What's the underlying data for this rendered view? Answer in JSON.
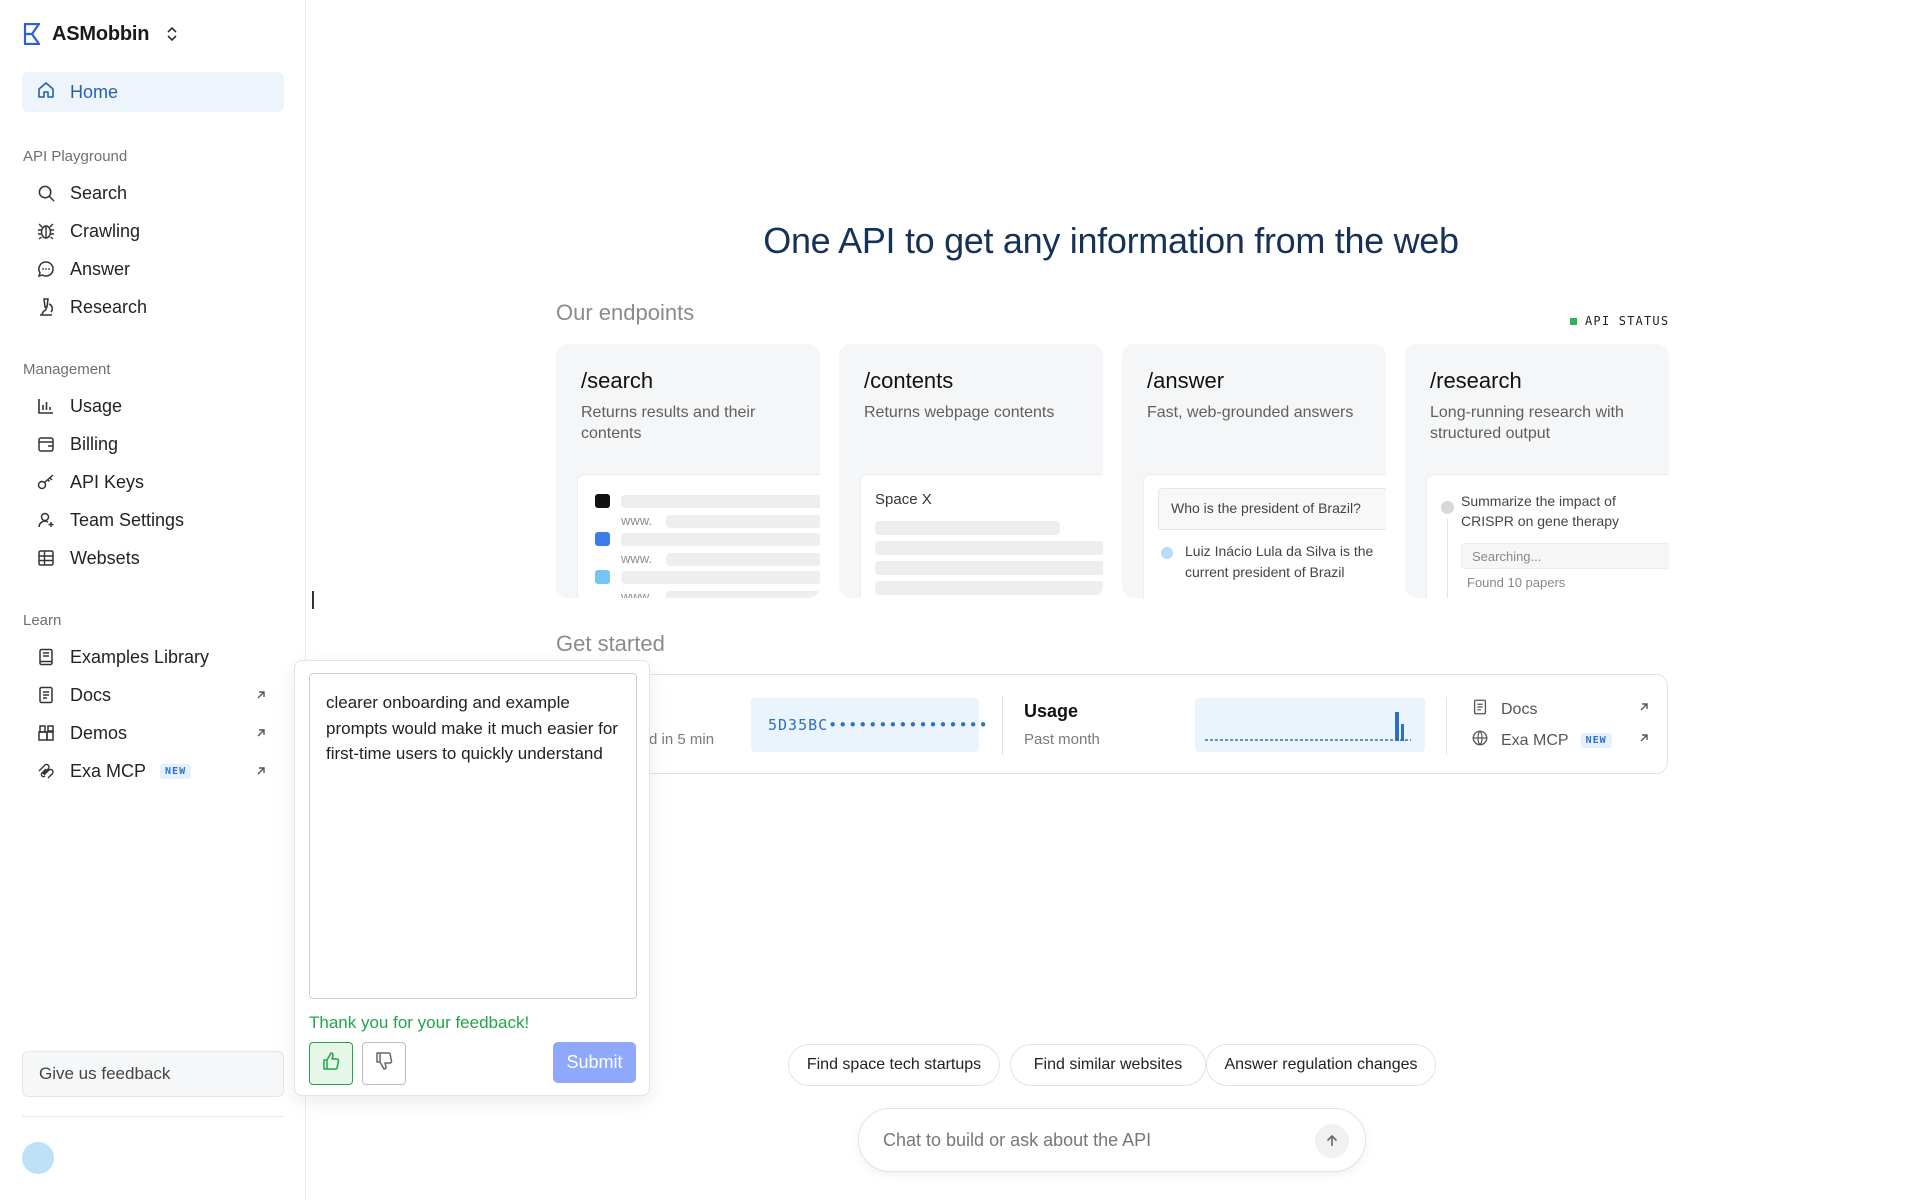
{
  "workspace": {
    "name": "ASMobbin"
  },
  "sidebar": {
    "home": "Home",
    "sections": [
      {
        "title": "API Playground",
        "items": [
          {
            "label": "Search",
            "icon": "search-icon"
          },
          {
            "label": "Crawling",
            "icon": "bug-icon"
          },
          {
            "label": "Answer",
            "icon": "chat-bubble-icon"
          },
          {
            "label": "Research",
            "icon": "microscope-icon"
          }
        ]
      },
      {
        "title": "Management",
        "items": [
          {
            "label": "Usage",
            "icon": "bar-chart-icon"
          },
          {
            "label": "Billing",
            "icon": "wallet-icon"
          },
          {
            "label": "API Keys",
            "icon": "key-icon"
          },
          {
            "label": "Team Settings",
            "icon": "user-icon"
          },
          {
            "label": "Websets",
            "icon": "grid-icon"
          }
        ]
      },
      {
        "title": "Learn",
        "items": [
          {
            "label": "Examples Library",
            "icon": "book-icon"
          },
          {
            "label": "Docs",
            "icon": "document-icon"
          },
          {
            "label": "Demos",
            "icon": "blocks-icon"
          },
          {
            "label": "Exa MCP",
            "icon": "mcp-icon",
            "badge": "NEW"
          }
        ]
      }
    ],
    "feedback_button": "Give us feedback"
  },
  "main": {
    "headline": "One API to get any information from the web",
    "endpoints_title": "Our endpoints",
    "api_status": "API STATUS",
    "endpoints": [
      {
        "name": "/search",
        "desc": "Returns results and their contents",
        "preview": {
          "items": [
            "www.",
            "www.",
            "www."
          ]
        }
      },
      {
        "name": "/contents",
        "desc": "Returns webpage contents",
        "preview": {
          "title": "Space X"
        }
      },
      {
        "name": "/answer",
        "desc": "Fast, web-grounded answers",
        "preview": {
          "question": "Who is the president of Brazil?",
          "answer": "Luiz Inácio Lula da Silva is the current president of Brazil"
        }
      },
      {
        "name": "/research",
        "desc": "Long-running research with structured output",
        "preview": {
          "task": "Summarize the impact of CRISPR on gene therapy",
          "status": "Searching...",
          "found": "Found 10 papers"
        }
      }
    ],
    "get_started_title": "Get started",
    "get_started": {
      "partial_text": "d in 5 min",
      "api_key_masked": "5D35BC••••••••••••••••",
      "usage_title": "Usage",
      "usage_period": "Past month",
      "links": [
        {
          "label": "Docs",
          "icon": "document-icon"
        },
        {
          "label": "Exa MCP",
          "icon": "globe-icon",
          "badge": "NEW"
        }
      ]
    },
    "suggestions": [
      "Find space tech startups",
      "Find similar websites",
      "Answer regulation changes"
    ],
    "chat": {
      "placeholder": "Chat to build or ask about the API"
    }
  },
  "feedback_popover": {
    "text": "clearer onboarding and example prompts would make it much easier for first-time users to quickly understand",
    "thanks": "Thank you for your feedback!",
    "submit": "Submit"
  },
  "colors": {
    "accent": "#2462a8",
    "success": "#22a54a",
    "submit": "#8fa8fb",
    "status": "#2db35d"
  }
}
